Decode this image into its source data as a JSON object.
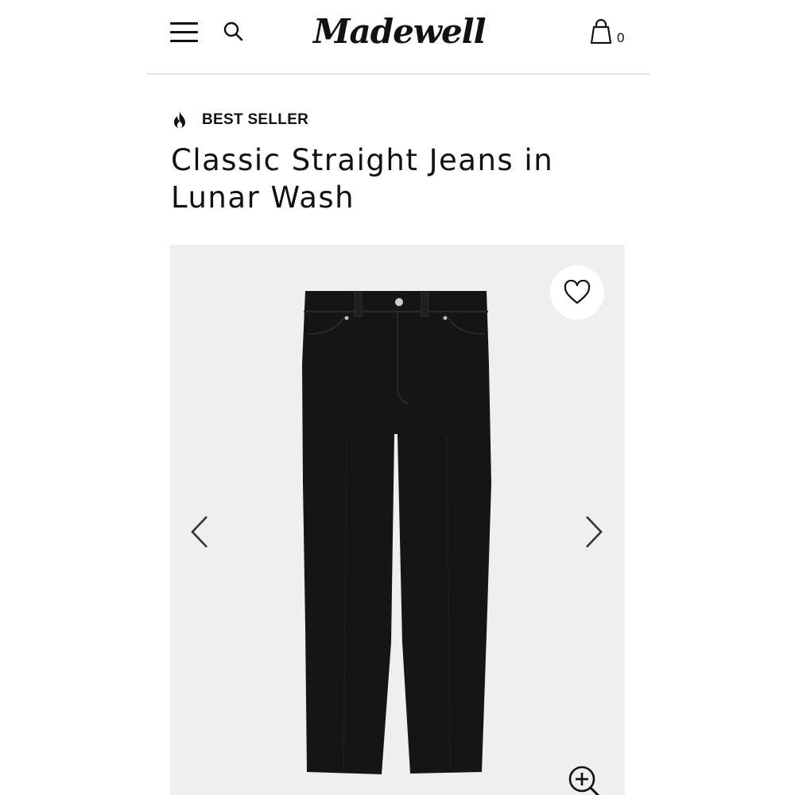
{
  "header": {
    "brand": "Madewell",
    "bag_count": "0"
  },
  "product": {
    "badge": "BEST SELLER",
    "title": "Classic Straight Jeans in Lunar Wash"
  },
  "icons": {
    "menu": "hamburger-menu-icon",
    "search": "search-icon",
    "bag": "shopping-bag-icon",
    "flame": "flame-icon",
    "wishlist": "heart-icon",
    "prev": "chevron-left-icon",
    "next": "chevron-right-icon",
    "zoom": "zoom-in-icon"
  },
  "colors": {
    "text": "#111111",
    "image_background": "#efefef",
    "jeans": "#141414"
  }
}
